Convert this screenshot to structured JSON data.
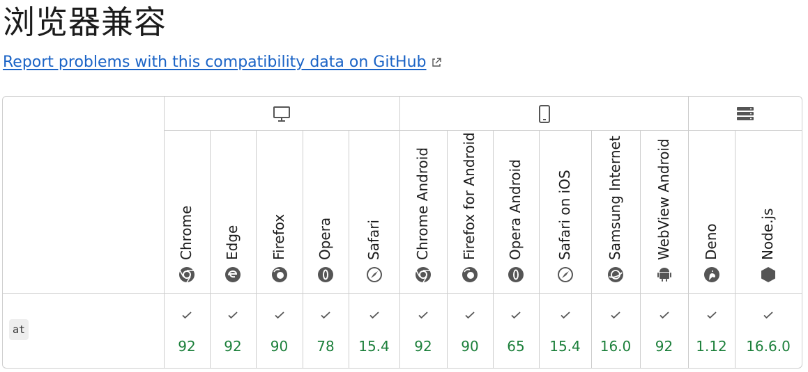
{
  "title": "浏览器兼容",
  "report_link": "Report problems with this compatibility data on GitHub",
  "platforms": [
    {
      "name": "desktop",
      "icon": "desktop-icon"
    },
    {
      "name": "mobile",
      "icon": "mobile-icon"
    },
    {
      "name": "server",
      "icon": "server-icon"
    }
  ],
  "browsers": [
    {
      "name": "Chrome",
      "version": "92"
    },
    {
      "name": "Edge",
      "version": "92"
    },
    {
      "name": "Firefox",
      "version": "90"
    },
    {
      "name": "Opera",
      "version": "78"
    },
    {
      "name": "Safari",
      "version": "15.4"
    },
    {
      "name": "Chrome Android",
      "version": "92"
    },
    {
      "name": "Firefox for Android",
      "version": "90"
    },
    {
      "name": "Opera Android",
      "version": "65"
    },
    {
      "name": "Safari on iOS",
      "version": "15.4"
    },
    {
      "name": "Samsung Internet",
      "version": "16.0"
    },
    {
      "name": "WebView Android",
      "version": "92"
    },
    {
      "name": "Deno",
      "version": "1.12"
    },
    {
      "name": "Node.js",
      "version": "16.6.0"
    }
  ],
  "feature": "at",
  "colors": {
    "link": "#1a63c6",
    "supported": "#1b7f3a",
    "border": "#cdcdcd"
  }
}
